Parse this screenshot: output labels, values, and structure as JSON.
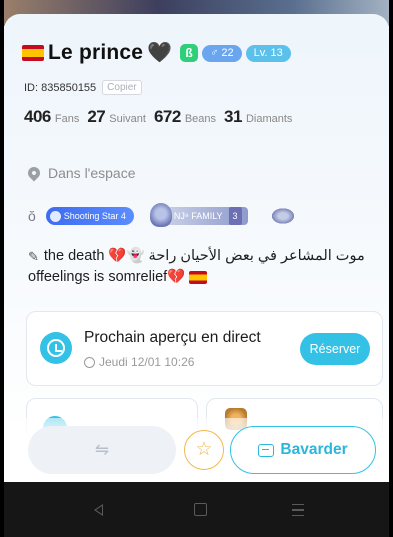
{
  "profile": {
    "name": "Le prince",
    "name_suffix_emoji": "🖤",
    "badges": {
      "friend_icon": "ß",
      "gender_age": "♂ 22",
      "level": "Lv. 13"
    },
    "id_text": "ID: 835850155",
    "copy_label": "Copier"
  },
  "stats": [
    {
      "value": "406",
      "label": "Fans"
    },
    {
      "value": "27",
      "label": "Suivant"
    },
    {
      "value": "672",
      "label": "Beans"
    },
    {
      "value": "31",
      "label": "Diamants"
    }
  ],
  "location": "Dans l'espace",
  "medals": {
    "shooting_star": "Shooting Star 4",
    "family_name": "NJ⁹ FAMILY",
    "family_level": "3"
  },
  "bio": {
    "line1": "the death 💔👻 موت المشاعر في بعض الأحيان راحة",
    "line2": "offeelings is somrelief💔"
  },
  "live_preview": {
    "title": "Prochain aperçu en direct",
    "datetime": "Jeudi 12/01 10:26",
    "reserve_label": "Réserver"
  },
  "actions": {
    "switch_glyph": "⇋",
    "star_glyph": "☆",
    "chat_label": "Bavarder"
  },
  "colors": {
    "accent": "#33c2e6",
    "gold": "#f2b94a",
    "flag_red": "#c60b1e",
    "flag_yellow": "#ffc400"
  }
}
